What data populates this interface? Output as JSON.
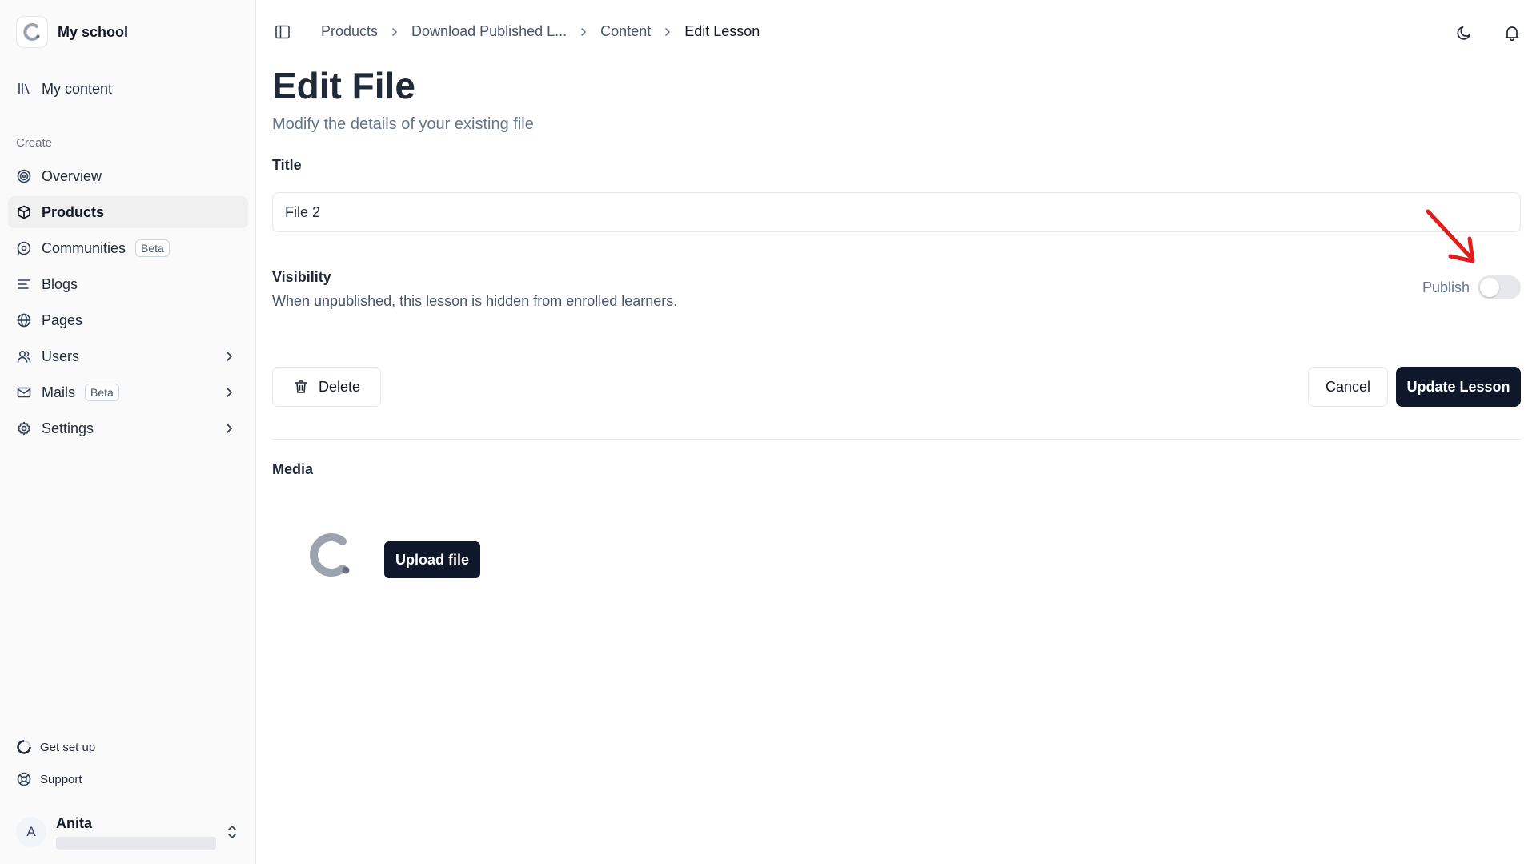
{
  "sidebar": {
    "brand": "My school",
    "my_content": "My content",
    "section_create": "Create",
    "items": [
      {
        "label": "Overview",
        "icon": "target-icon"
      },
      {
        "label": "Products",
        "icon": "box-icon",
        "active": true
      },
      {
        "label": "Communities",
        "icon": "message-circle-icon",
        "badge": "Beta"
      },
      {
        "label": "Blogs",
        "icon": "text-lines-icon"
      },
      {
        "label": "Pages",
        "icon": "globe-icon"
      },
      {
        "label": "Users",
        "icon": "users-icon"
      },
      {
        "label": "Mails",
        "icon": "mail-icon",
        "badge": "Beta"
      },
      {
        "label": "Settings",
        "icon": "gear-icon"
      }
    ],
    "footer": {
      "get_set_up": "Get set up",
      "support": "Support"
    },
    "user": {
      "initial": "A",
      "name": "Anita"
    }
  },
  "breadcrumb": [
    "Products",
    "Download Published L...",
    "Content",
    "Edit Lesson"
  ],
  "page": {
    "title": "Edit File",
    "subtitle": "Modify the details of your existing file",
    "title_label": "Title",
    "title_value": "File 2",
    "visibility_label": "Visibility",
    "visibility_desc": "When unpublished, this lesson is hidden from enrolled learners.",
    "publish_label": "Publish",
    "publish_on": false,
    "delete_label": "Delete",
    "cancel_label": "Cancel",
    "update_label": "Update Lesson",
    "media_label": "Media",
    "upload_label": "Upload file"
  },
  "colors": {
    "primary_dark": "#0f172a",
    "annotation_arrow": "#e11d1d",
    "sidebar_bg": "#fafafa"
  }
}
